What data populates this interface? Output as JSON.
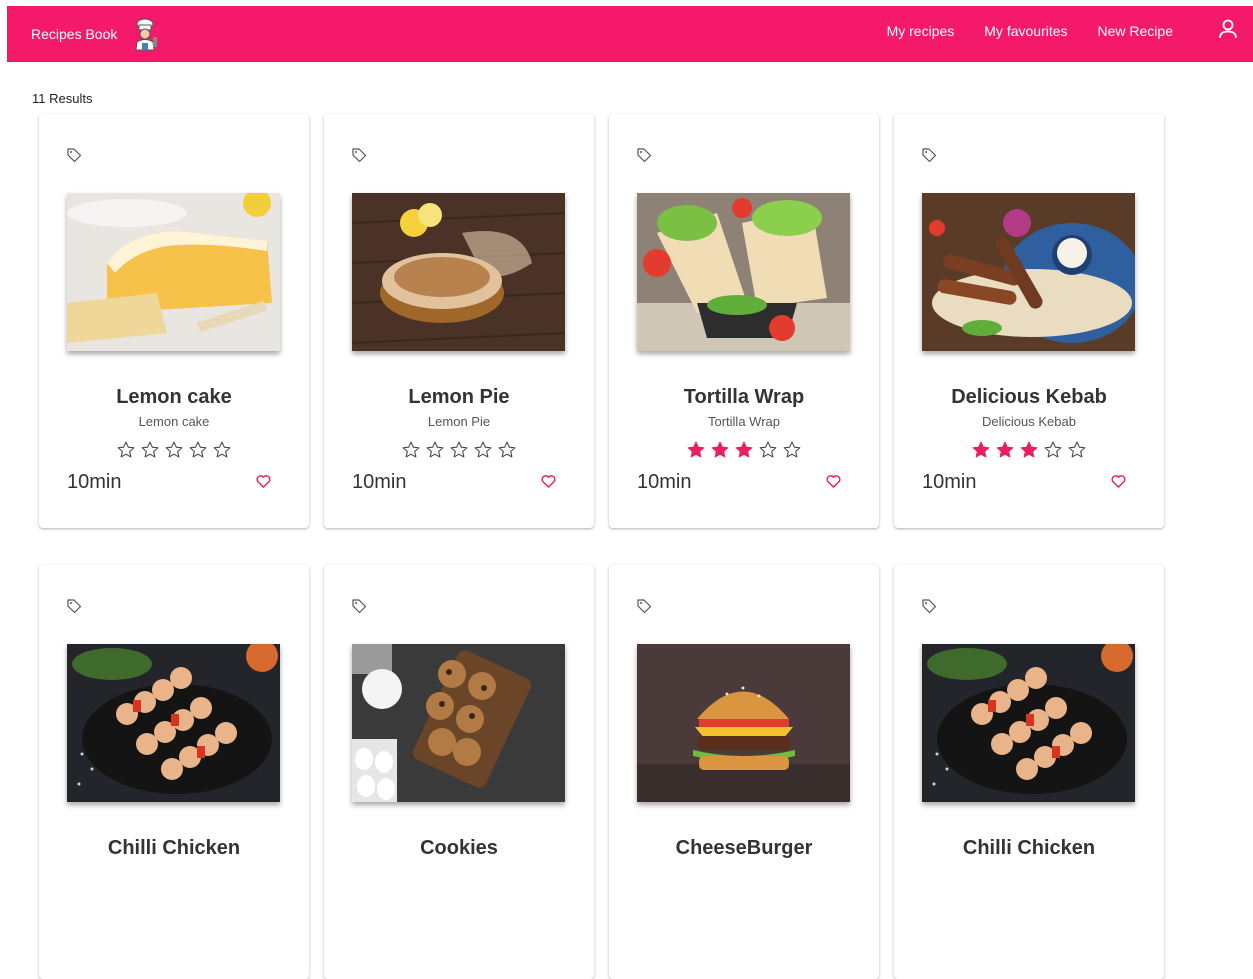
{
  "navbar": {
    "brand": "Recipes Book",
    "links": [
      "My recipes",
      "My favourites",
      "New Recipe"
    ],
    "color": "#f5196a"
  },
  "results": {
    "label": "11 Results"
  },
  "accent": "#e91e63",
  "recipes": [
    {
      "title": "Lemon cake",
      "subtitle": "Lemon cake",
      "rating": 0,
      "time": "10min",
      "photo": "lemon-cake-photo"
    },
    {
      "title": "Lemon Pie",
      "subtitle": "Lemon Pie",
      "rating": 0,
      "time": "10min",
      "photo": "lemon-pie-photo"
    },
    {
      "title": "Tortilla Wrap",
      "subtitle": "Tortilla Wrap",
      "rating": 3,
      "time": "10min",
      "photo": "tortilla-wrap-photo"
    },
    {
      "title": "Delicious Kebab",
      "subtitle": "Delicious Kebab",
      "rating": 3,
      "time": "10min",
      "photo": "kebab-photo"
    },
    {
      "title": "Chilli Chicken",
      "photo": "chicken-skewers-photo"
    },
    {
      "title": "Cookies",
      "photo": "cookies-photo"
    },
    {
      "title": "CheeseBurger",
      "photo": "cheeseburger-photo"
    },
    {
      "title": "Chilli Chicken",
      "photo": "chicken-skewers-photo"
    }
  ]
}
